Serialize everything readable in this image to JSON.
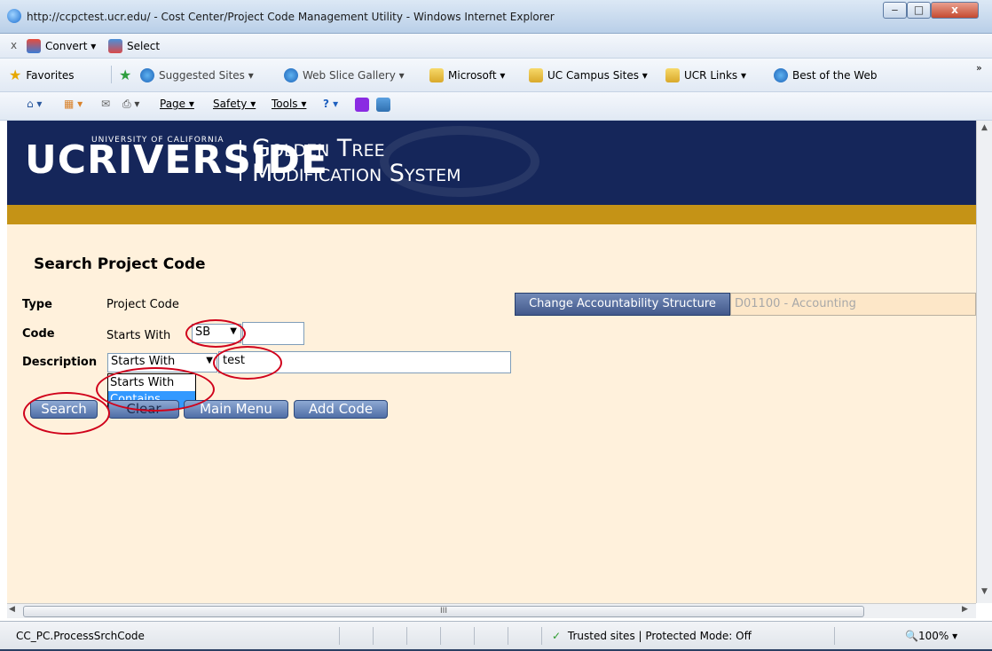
{
  "window": {
    "title": "http://ccpctest.ucr.edu/ - Cost Center/Project Code Management Utility - Windows Internet Explorer",
    "min": "‒",
    "max": "□",
    "close": "x"
  },
  "convert_bar": {
    "close": "x",
    "convert": "Convert ▾",
    "select": "Select"
  },
  "favorites_bar": {
    "favorites": "Favorites",
    "items": [
      {
        "label": "Suggested Sites ▾",
        "icon": "ie-icon"
      },
      {
        "label": "Web Slice Gallery ▾",
        "icon": "ie-icon"
      },
      {
        "label": "Microsoft ▾",
        "icon": "folder-icon"
      },
      {
        "label": "UC Campus Sites ▾",
        "icon": "folder-icon"
      },
      {
        "label": "UCR Links ▾",
        "icon": "folder-icon"
      },
      {
        "label": "Best of the Web",
        "icon": "ie-icon"
      }
    ],
    "overflow": "»"
  },
  "command_bar": {
    "home": "⌂ ▾",
    "feeds": "▦ ▾",
    "mail": "✉",
    "print": "⎙ ▾",
    "page": "Page ▾",
    "safety": "Safety ▾",
    "tools": "Tools ▾",
    "help": "? ▾"
  },
  "banner": {
    "logo": "UCRIVERSIDE",
    "university": "UNIVERSITY OF CALIFORNIA",
    "system_title_line1": "Golden Tree",
    "system_title_line2": "Modification System"
  },
  "page": {
    "title": "Search Project Code"
  },
  "form": {
    "type_label": "Type",
    "type_value": "Project Code",
    "code_label": "Code",
    "code_operator": "Starts With",
    "code_prefix": "SB",
    "code_value": "",
    "description_label": "Description",
    "description_operator": "Starts With",
    "description_value": "test",
    "dropdown_options": [
      "Starts With",
      "Contains"
    ],
    "dropdown_highlighted": "Contains"
  },
  "buttons": {
    "search": "Search",
    "clear": "Clear",
    "main_menu": "Main Menu",
    "add_code": "Add Code"
  },
  "accountability": {
    "button": "Change Accountability Structure",
    "value": "D01100 - Accounting"
  },
  "scroll": {
    "grip": "III",
    "left": "◀",
    "right": "▶",
    "up": "▲",
    "down": "▼"
  },
  "status": {
    "text": "CC_PC.ProcessSrchCode",
    "zone": "Trusted sites | Protected Mode: Off",
    "zone_icon": "✓",
    "zoom": "🔍100%  ▾"
  },
  "colors": {
    "banner": "#15265a",
    "gold": "#c59316",
    "page_bg": "#fff1dc",
    "button": "#4f6ea6",
    "annotation": "#d0021b"
  }
}
